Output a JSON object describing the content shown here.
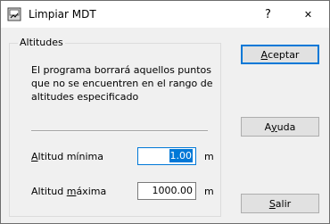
{
  "window": {
    "title": "Limpiar MDT",
    "help_glyph": "?",
    "close_glyph": "✕"
  },
  "group": {
    "label": "Altitudes",
    "description": "El programa borrará aquellos puntos que no se encuentren en el rango de altitudes especificado"
  },
  "fields": {
    "min": {
      "mnemonic": "A",
      "rest": "ltitud mínima",
      "value": "1.00",
      "unit": "m"
    },
    "max": {
      "pre": "Altitud ",
      "mnemonic": "m",
      "rest": "áxima",
      "value": "1000.00",
      "unit": "m"
    }
  },
  "buttons": {
    "accept": {
      "mnemonic": "A",
      "rest": "ceptar"
    },
    "help": {
      "pre": "A",
      "mnemonic": "y",
      "rest": "uda"
    },
    "exit": {
      "mnemonic": "S",
      "rest": "alir"
    }
  },
  "colors": {
    "accent": "#0078d7",
    "dialog_bg": "#f0f0f0",
    "button_bg": "#e1e1e1"
  }
}
